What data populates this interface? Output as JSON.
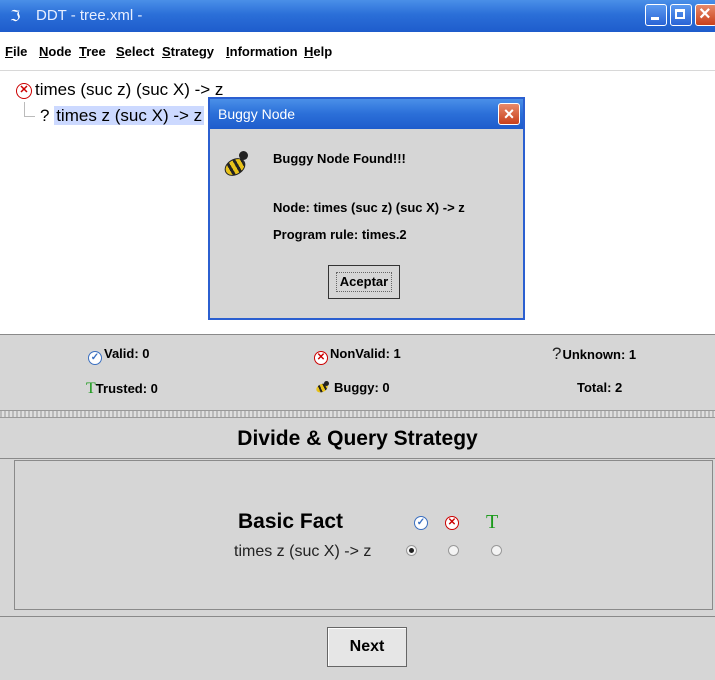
{
  "window": {
    "title": "DDT  - tree.xml -"
  },
  "menu": [
    "File",
    "Node",
    "Tree",
    "Select",
    "Strategy",
    "Information",
    "Help"
  ],
  "tree": {
    "root": "times (suc z) (suc X) -> z",
    "child_prefix": "?",
    "child": "times z (suc X) -> z"
  },
  "stats": {
    "valid": "Valid:  0",
    "nonvalid": "NonValid:  1",
    "unknown": "Unknown:  1",
    "trusted": "Trusted:  0",
    "buggy": "Buggy:  0",
    "total": "Total:  2"
  },
  "strategy": {
    "title": "Divide & Query Strategy",
    "heading": "Basic Fact",
    "fact": "times z (suc X)  ->  z",
    "trusted_symbol": "T",
    "selected": "valid",
    "next_label": "Next"
  },
  "dialog": {
    "title": "Buggy Node",
    "message": "Buggy Node Found!!!",
    "node": "Node: times (suc z) (suc X)  ->  z",
    "rule": "Program rule: times.2",
    "button": "Aceptar"
  },
  "colors": {
    "titlebar": "#2b6fd8",
    "selection": "#ccd9ff",
    "panel": "#d6d6d6",
    "trusted": "#1a9a1a",
    "error": "#cc0000"
  }
}
